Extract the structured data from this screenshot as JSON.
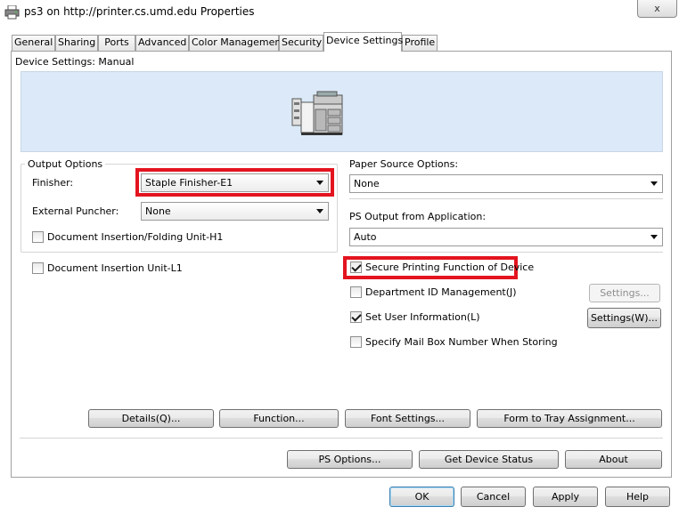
{
  "window": {
    "title": "ps3 on http://printer.cs.umd.edu Properties",
    "close_glyph": "x"
  },
  "tabs": [
    {
      "label": "General",
      "active": false
    },
    {
      "label": "Sharing",
      "active": false
    },
    {
      "label": "Ports",
      "active": false
    },
    {
      "label": "Advanced",
      "active": false
    },
    {
      "label": "Color Management",
      "active": false
    },
    {
      "label": "Security",
      "active": false
    },
    {
      "label": "Device Settings",
      "active": true
    },
    {
      "label": "Profile",
      "active": false
    }
  ],
  "device_settings": {
    "mode_label": "Device Settings: Manual"
  },
  "output_options": {
    "group_label": "Output Options",
    "finisher_label": "Finisher:",
    "finisher_value": "Staple Finisher-E1",
    "puncher_label": "External Puncher:",
    "puncher_value": "None",
    "doc_insertion_folding_label": "Document Insertion/Folding Unit-H1",
    "doc_insertion_folding_checked": false
  },
  "doc_insertion_unit": {
    "label": "Document Insertion Unit-L1",
    "checked": false
  },
  "paper_source": {
    "label": "Paper Source Options:",
    "value": "None"
  },
  "ps_output": {
    "label": "PS Output from Application:",
    "value": "Auto"
  },
  "options": {
    "secure_printing": {
      "label": "Secure Printing Function of Device",
      "checked": true
    },
    "department_id": {
      "label": "Department ID Management(J)",
      "checked": false,
      "button": "Settings..."
    },
    "user_info": {
      "label": "Set User Information(L)",
      "checked": true,
      "button": "Settings(W)..."
    },
    "mail_box": {
      "label": "Specify Mail Box Number When Storing",
      "checked": false
    }
  },
  "action_buttons": {
    "details": "Details(Q)...",
    "function": "Function...",
    "font_settings": "Font Settings...",
    "form_to_tray": "Form to Tray Assignment..."
  },
  "bottom_buttons": {
    "ps_options": "PS Options...",
    "get_status": "Get Device Status",
    "about": "About"
  },
  "dialog_buttons": {
    "ok": "OK",
    "cancel": "Cancel",
    "apply": "Apply",
    "help": "Help"
  },
  "icons": {
    "printer": "printer-icon",
    "device": "copier-device-icon"
  },
  "colors": {
    "highlight": "#e3141f",
    "preview_bg": "#dbe9f8"
  }
}
